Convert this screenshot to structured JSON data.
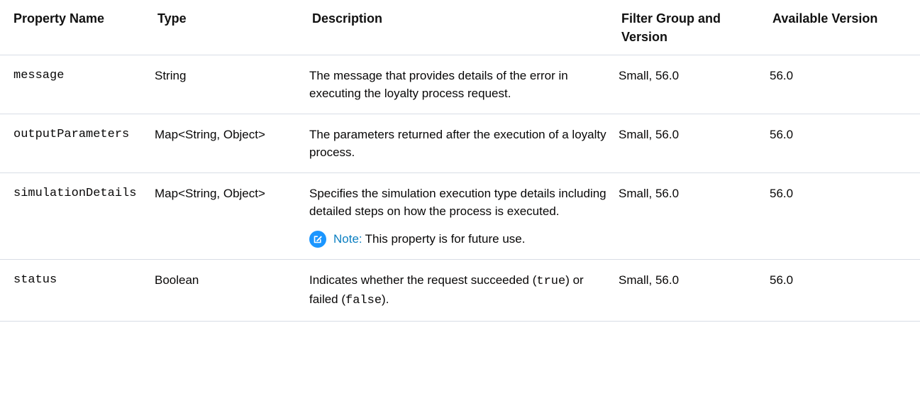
{
  "table": {
    "headers": {
      "property_name": "Property Name",
      "type": "Type",
      "description": "Description",
      "filter_group": "Filter Group and Version",
      "available_version": "Available Version"
    },
    "rows": [
      {
        "name": "message",
        "type": "String",
        "description": "The message that provides details of the error in executing the loyalty process request.",
        "filter": "Small, 56.0",
        "available": "56.0"
      },
      {
        "name": "outputParameters",
        "type": "Map<String, Object>",
        "description": "The parameters returned after the execution of a loyalty process.",
        "filter": "Small, 56.0",
        "available": "56.0"
      },
      {
        "name": "simulationDetails",
        "type": "Map<String, Object>",
        "description": "Specifies the simulation execution type details including detailed steps on how the process is executed.",
        "note_label": "Note:",
        "note_text": "This property is for future use.",
        "note_icon": "edit-note-icon",
        "filter": "Small, 56.0",
        "available": "56.0"
      },
      {
        "name": "status",
        "type": "Boolean",
        "description_before": "Indicates whether the request succeeded (",
        "description_true": "true",
        "description_middle": ") or failed (",
        "description_false": "false",
        "description_after": ").",
        "filter": "Small, 56.0",
        "available": "56.0"
      }
    ]
  },
  "colors": {
    "note_accent": "#0b7fc1",
    "divider": "#d8dde6",
    "text": "#080707"
  }
}
